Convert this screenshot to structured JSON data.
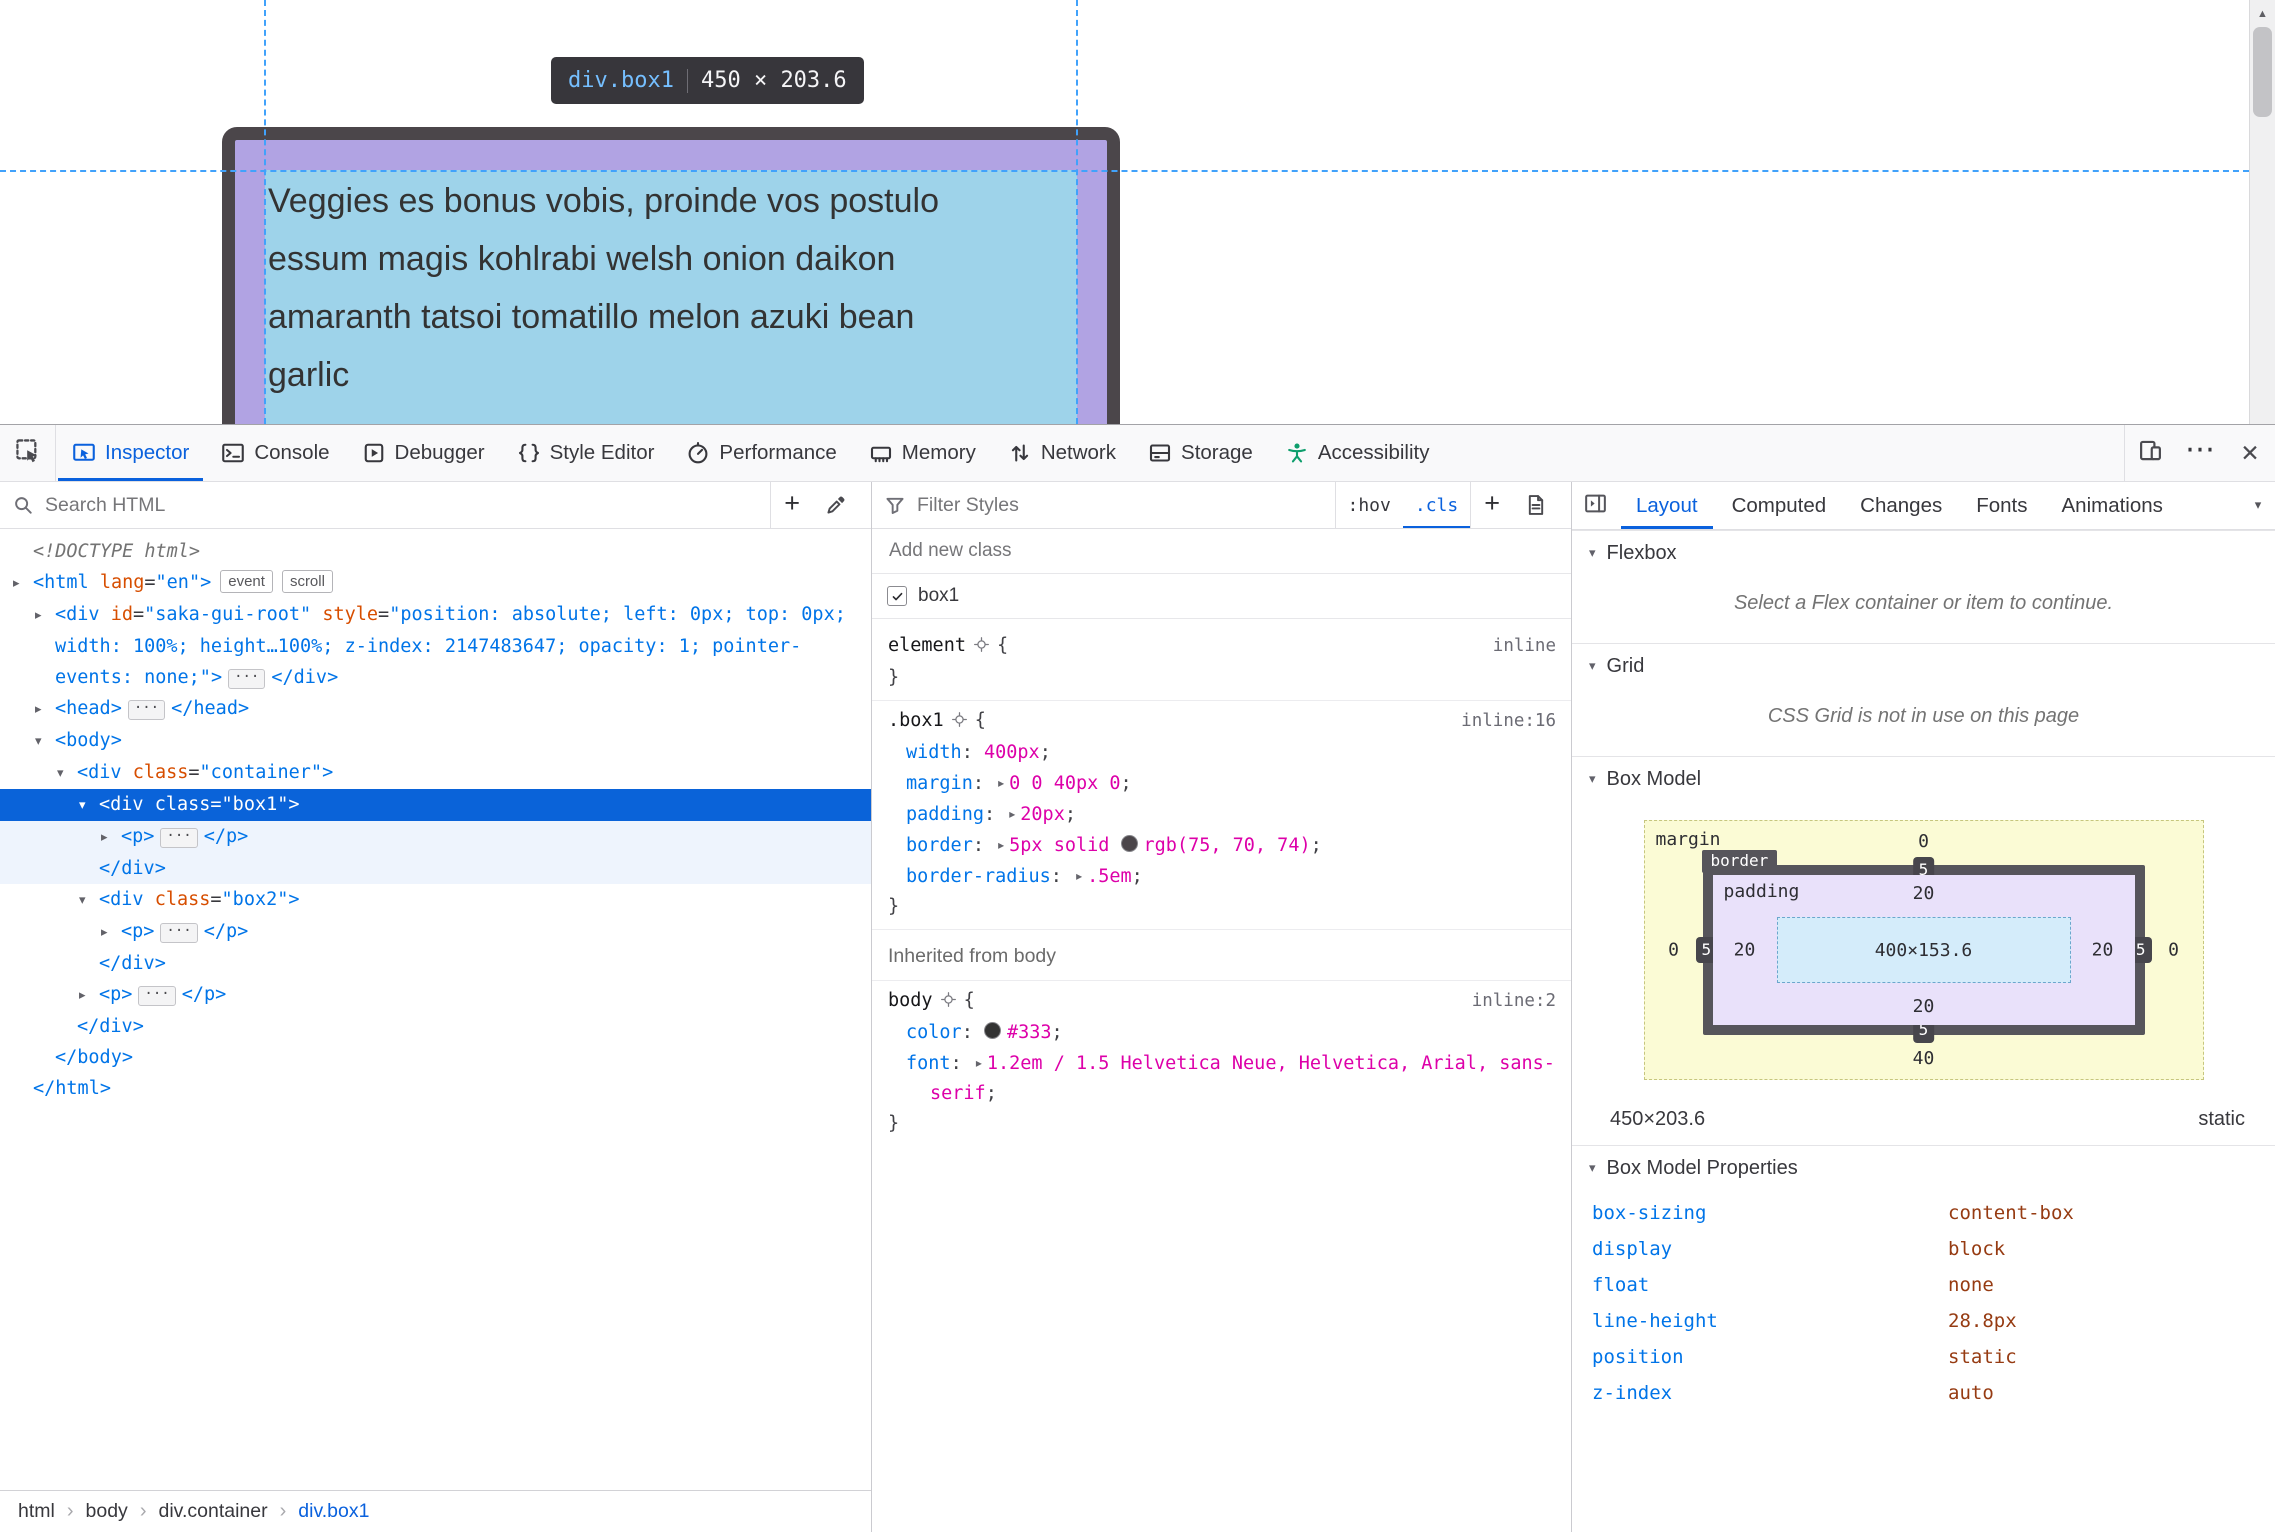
{
  "icons": {
    "plus": "+",
    "close": "✕",
    "menu": "⋯",
    "scroll_up": "▲",
    "dropdown": "▾",
    "chevron": "›",
    "twisty_open": "▾",
    "twisty_closed": "▸"
  },
  "page": {
    "infobar": {
      "selector": "div.box1",
      "dimensions": "450 × 203.6"
    },
    "content_lines": [
      "Veggies es bonus vobis, proinde vos postulo",
      "essum magis kohlrabi welsh onion daikon",
      "amaranth tatsoi tomatillo melon azuki bean",
      "garlic"
    ]
  },
  "toolbar": {
    "tabs": [
      {
        "id": "inspector",
        "label": "Inspector",
        "active": true
      },
      {
        "id": "console",
        "label": "Console"
      },
      {
        "id": "debugger",
        "label": "Debugger"
      },
      {
        "id": "style-editor",
        "label": "Style Editor"
      },
      {
        "id": "performance",
        "label": "Performance"
      },
      {
        "id": "memory",
        "label": "Memory"
      },
      {
        "id": "network",
        "label": "Network"
      },
      {
        "id": "storage",
        "label": "Storage"
      },
      {
        "id": "accessibility",
        "label": "Accessibility"
      }
    ]
  },
  "markup": {
    "search_placeholder": "Search HTML",
    "rows": [
      {
        "i": 0,
        "a": null,
        "parts": [
          [
            "<!DOCTYPE html>",
            "d"
          ]
        ]
      },
      {
        "i": 0,
        "a": "c",
        "parts": [
          [
            "<html ",
            "t"
          ],
          [
            "lang",
            "a"
          ],
          [
            "=",
            "x"
          ],
          [
            "\"en\"",
            "v"
          ],
          [
            ">",
            "t"
          ],
          [
            "event",
            "b"
          ],
          [
            "scroll",
            "b"
          ]
        ]
      },
      {
        "i": 1,
        "a": "c",
        "parts": [
          [
            "<div ",
            "t"
          ],
          [
            "id",
            "a"
          ],
          [
            "=",
            "x"
          ],
          [
            "\"saka-gui-root\"",
            "v"
          ],
          [
            " ",
            "x"
          ],
          [
            "style",
            "a"
          ],
          [
            "=",
            "x"
          ],
          [
            "\"position: absolute; left: 0px; top: 0px; width: 100%; height…100%; z-index: 2147483647; opacity: 1; pointer-events: none;\"",
            "v"
          ],
          [
            ">",
            "t"
          ],
          [
            "···",
            "e"
          ],
          [
            "</div>",
            "t"
          ]
        ]
      },
      {
        "i": 1,
        "a": "c",
        "parts": [
          [
            "<head>",
            "t"
          ],
          [
            "···",
            "e"
          ],
          [
            "</head>",
            "t"
          ]
        ]
      },
      {
        "i": 1,
        "a": "o",
        "parts": [
          [
            "<body>",
            "t"
          ]
        ]
      },
      {
        "i": 2,
        "a": "o",
        "parts": [
          [
            "<div ",
            "t"
          ],
          [
            "class",
            "a"
          ],
          [
            "=",
            "x"
          ],
          [
            "\"container\"",
            "v"
          ],
          [
            ">",
            "t"
          ]
        ]
      },
      {
        "i": 3,
        "a": "o",
        "sel": true,
        "parts": [
          [
            "<div ",
            "t"
          ],
          [
            "class",
            "a"
          ],
          [
            "=",
            "x"
          ],
          [
            "\"box1\"",
            "v"
          ],
          [
            ">",
            "t"
          ]
        ]
      },
      {
        "i": 4,
        "a": "c",
        "tint": true,
        "parts": [
          [
            "<p>",
            "t"
          ],
          [
            "···",
            "e"
          ],
          [
            "</p>",
            "t"
          ]
        ]
      },
      {
        "i": 3,
        "a": null,
        "tint": true,
        "parts": [
          [
            "</div>",
            "t"
          ]
        ]
      },
      {
        "i": 3,
        "a": "o",
        "parts": [
          [
            "<div ",
            "t"
          ],
          [
            "class",
            "a"
          ],
          [
            "=",
            "x"
          ],
          [
            "\"box2\"",
            "v"
          ],
          [
            ">",
            "t"
          ]
        ]
      },
      {
        "i": 4,
        "a": "c",
        "parts": [
          [
            "<p>",
            "t"
          ],
          [
            "···",
            "e"
          ],
          [
            "</p>",
            "t"
          ]
        ]
      },
      {
        "i": 3,
        "a": null,
        "parts": [
          [
            "</div>",
            "t"
          ]
        ]
      },
      {
        "i": 3,
        "a": "c",
        "parts": [
          [
            "<p>",
            "t"
          ],
          [
            "···",
            "e"
          ],
          [
            "</p>",
            "t"
          ]
        ]
      },
      {
        "i": 2,
        "a": null,
        "parts": [
          [
            "</div>",
            "t"
          ]
        ]
      },
      {
        "i": 1,
        "a": null,
        "parts": [
          [
            "</body>",
            "t"
          ]
        ]
      },
      {
        "i": 0,
        "a": null,
        "parts": [
          [
            "</html>",
            "t"
          ]
        ]
      }
    ]
  },
  "rules": {
    "filter_placeholder": "Filter Styles",
    "pseudo_toggle": ":hov",
    "class_toggle_label": ".cls",
    "add_class_placeholder": "Add new class",
    "class_item": {
      "label": "box1",
      "checked": true
    },
    "blocks": [
      {
        "selector": "element",
        "location": "inline",
        "props": []
      },
      {
        "selector": ".box1",
        "location": "inline:16",
        "props": [
          {
            "name": "width",
            "value": "400px"
          },
          {
            "name": "margin",
            "arrow": true,
            "value": "0 0 40px 0"
          },
          {
            "name": "padding",
            "arrow": true,
            "value": "20px"
          },
          {
            "name": "border",
            "arrow": true,
            "pre": "5px solid ",
            "swatch": "#4b464a",
            "value": "rgb(75, 70, 74)"
          },
          {
            "name": "border-radius",
            "arrow": true,
            "value": ".5em"
          }
        ]
      }
    ],
    "inherited_header": "Inherited from body",
    "inherited_blocks": [
      {
        "selector": "body",
        "location": "inline:2",
        "props": [
          {
            "name": "color",
            "swatch": "#333333",
            "value": "#333"
          },
          {
            "name": "font",
            "arrow": true,
            "value": "1.2em / 1.5 Helvetica Neue, Helvetica, Arial, sans-serif"
          }
        ]
      }
    ]
  },
  "layout_panel": {
    "tabs": [
      {
        "id": "layout",
        "label": "Layout",
        "active": true
      },
      {
        "id": "computed",
        "label": "Computed"
      },
      {
        "id": "changes",
        "label": "Changes"
      },
      {
        "id": "fonts",
        "label": "Fonts"
      },
      {
        "id": "animations",
        "label": "Animations"
      }
    ],
    "flexbox": {
      "title": "Flexbox",
      "message": "Select a Flex container or item to continue."
    },
    "grid": {
      "title": "Grid",
      "message": "CSS Grid is not in use on this page"
    },
    "box_model": {
      "title": "Box Model",
      "margin_label": "margin",
      "border_label": "border",
      "padding_label": "padding",
      "margin": {
        "top": "0",
        "right": "0",
        "bottom": "40",
        "left": "0"
      },
      "border": {
        "top": "5",
        "right": "5",
        "bottom": "5",
        "left": "5"
      },
      "padding": {
        "top": "20",
        "right": "20",
        "bottom": "20",
        "left": "20"
      },
      "content": "400×153.6",
      "element_size": "450×203.6",
      "position": "static"
    },
    "box_model_properties": {
      "title": "Box Model Properties",
      "items": [
        [
          "box-sizing",
          "content-box"
        ],
        [
          "display",
          "block"
        ],
        [
          "float",
          "none"
        ],
        [
          "line-height",
          "28.8px"
        ],
        [
          "position",
          "static"
        ],
        [
          "z-index",
          "auto"
        ]
      ]
    }
  },
  "breadcrumbs": {
    "items": [
      "html",
      "body",
      "div.container",
      "div.box1"
    ]
  }
}
